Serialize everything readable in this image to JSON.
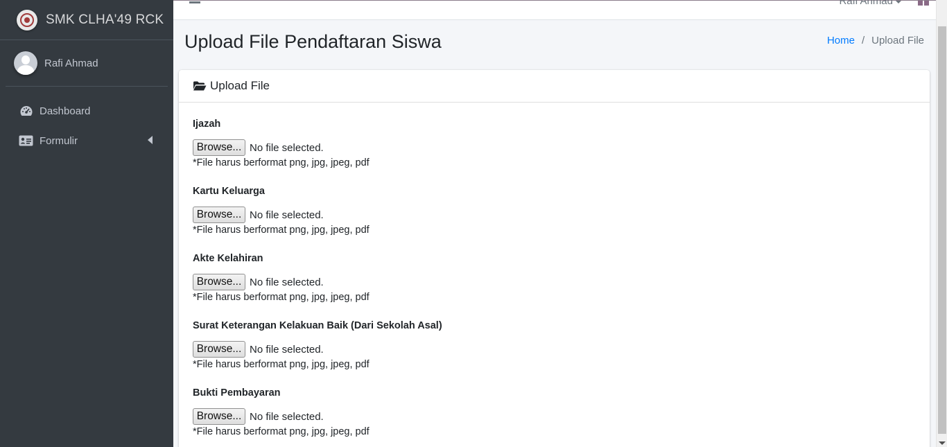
{
  "brand": {
    "name": "SMK CLHA'49 RCK",
    "logo_icon": "school-emblem"
  },
  "user_panel": {
    "name": "Rafi Ahmad"
  },
  "sidebar": {
    "items": [
      {
        "label": "Dashboard",
        "icon": "tachometer-icon"
      },
      {
        "label": "Formulir",
        "icon": "id-card-icon",
        "has_submenu": true
      }
    ]
  },
  "topbar": {
    "user_name": "Rafi Ahmad"
  },
  "header": {
    "title": "Upload File Pendaftaran Siswa"
  },
  "breadcrumb": {
    "home": "Home",
    "separator": "/",
    "current": "Upload File"
  },
  "card": {
    "title": "Upload File",
    "fields": [
      {
        "label": "Ijazah",
        "button": "Browse...",
        "status": "No file selected.",
        "help": "*File harus berformat png, jpg, jpeg, pdf"
      },
      {
        "label": "Kartu Keluarga",
        "button": "Browse...",
        "status": "No file selected.",
        "help": "*File harus berformat png, jpg, jpeg, pdf"
      },
      {
        "label": "Akte Kelahiran",
        "button": "Browse...",
        "status": "No file selected.",
        "help": "*File harus berformat png, jpg, jpeg, pdf"
      },
      {
        "label": "Surat Keterangan Kelakuan Baik (Dari Sekolah Asal)",
        "button": "Browse...",
        "status": "No file selected.",
        "help": "*File harus berformat png, jpg, jpeg, pdf"
      },
      {
        "label": "Bukti Pembayaran",
        "button": "Browse...",
        "status": "No file selected.",
        "help": "*File harus berformat png, jpg, jpeg, pdf"
      }
    ]
  },
  "colors": {
    "sidebar_bg": "#343a40",
    "link": "#007bff",
    "content_bg": "#f4f6f9"
  }
}
